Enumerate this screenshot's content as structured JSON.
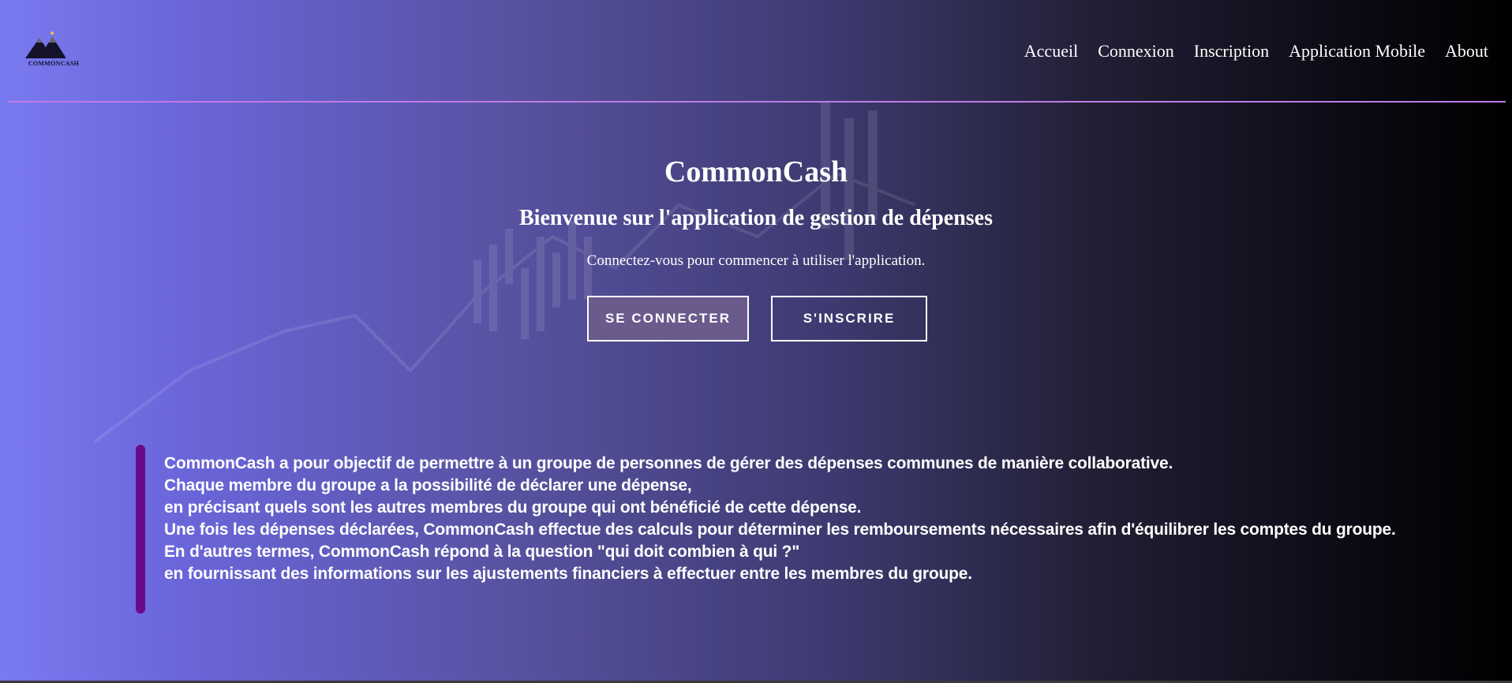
{
  "logo": {
    "text": "COMMONCASH",
    "icon": "mountain-logo-icon"
  },
  "nav": {
    "items": [
      {
        "label": "Accueil"
      },
      {
        "label": "Connexion"
      },
      {
        "label": "Inscription"
      },
      {
        "label": "Application Mobile"
      },
      {
        "label": "About"
      }
    ]
  },
  "hero": {
    "title": "CommonCash",
    "subtitle": "Bienvenue sur l'application de gestion de dépenses",
    "text": "Connectez-vous pour commencer à utiliser l'application."
  },
  "buttons": {
    "login": "SE CONNECTER",
    "signup": "S'INSCRIRE"
  },
  "description": {
    "lines": [
      "CommonCash a pour objectif de permettre à un groupe de personnes de gérer des dépenses communes de manière collaborative.",
      "Chaque membre du groupe a la possibilité de déclarer une dépense,",
      "en précisant quels sont les autres membres du groupe qui ont bénéficié de cette dépense.",
      "Une fois les dépenses déclarées, CommonCash effectue des calculs pour déterminer les remboursements nécessaires afin d'équilibrer les comptes du groupe.",
      "En d'autres termes, CommonCash répond à la question \"qui doit combien à qui ?\"",
      "en fournissant des informations sur les ajustements financiers à effectuer entre les membres du groupe."
    ]
  },
  "colors": {
    "accent_line": "#c07ae6",
    "quote_bar": "#6a0a8a",
    "login_button_bg": "#6b5a8c",
    "gradient_start": "#7a7af0",
    "gradient_end": "#000000"
  }
}
